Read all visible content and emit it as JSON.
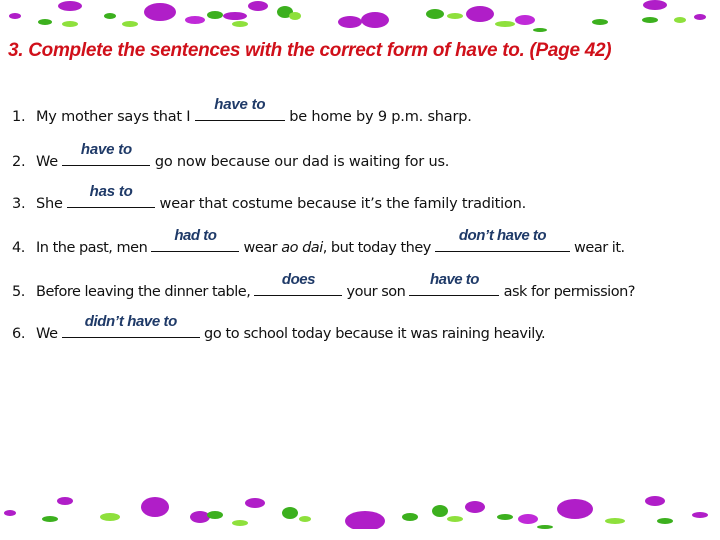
{
  "title": "3. Complete the sentences with the correct form of have to. (Page 42)",
  "colors": {
    "title": "#d0101a",
    "answer": "#1f3a68",
    "flower": "#b01ec8",
    "leaf": "#3cb01e"
  },
  "decoration": {
    "top": "flower-border",
    "bottom": "flower-border"
  },
  "items": [
    {
      "num": "1.",
      "before": "My mother says that I ",
      "answer": "have to",
      "after": " be home by 9 p.m. sharp."
    },
    {
      "num": "2.",
      "before": "We ",
      "answer": "have to",
      "after": " go now because our dad is waiting for us."
    },
    {
      "num": "3.",
      "before": "She ",
      "answer": "has to",
      "after": " wear that costume because it’s the family tradition."
    },
    {
      "num": "4.",
      "before": "In the past, men ",
      "answer": "had to",
      "mid1": " wear ",
      "mid_em": "ao dai",
      "mid2": ", but today they ",
      "answer2": "don’t have to",
      "after": " wear it."
    },
    {
      "num": "5.",
      "before": "Before leaving the dinner table, ",
      "answer": "does",
      "mid1": " your son ",
      "answer2": "have to",
      "after": " ask for permission?"
    },
    {
      "num": "6.",
      "before": "We ",
      "answer": "didn’t have to",
      "after": " go to school today because it was raining heavily."
    }
  ]
}
